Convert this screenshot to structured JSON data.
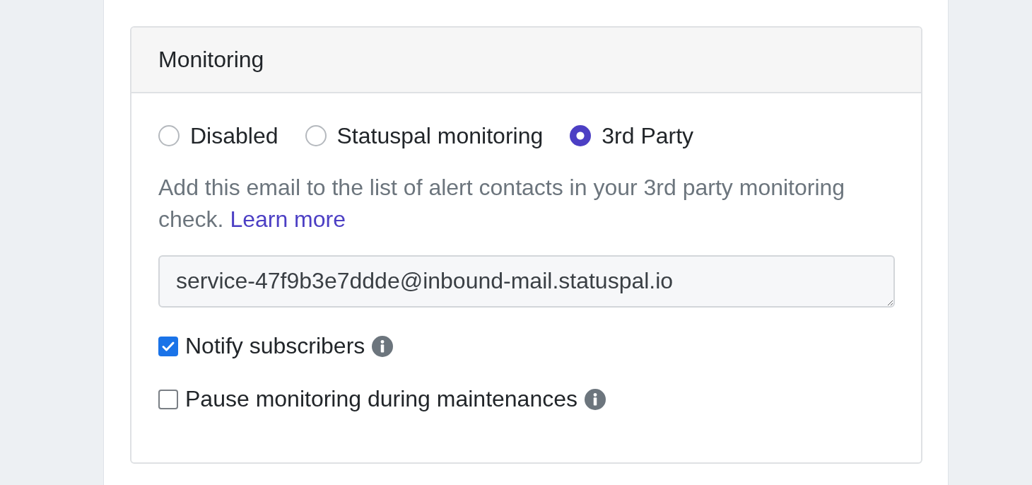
{
  "card": {
    "title": "Monitoring"
  },
  "monitoring_options": [
    {
      "label": "Disabled",
      "selected": false
    },
    {
      "label": "Statuspal monitoring",
      "selected": false
    },
    {
      "label": "3rd Party",
      "selected": true
    }
  ],
  "help": {
    "text": "Add this email to the list of alert contacts in your 3rd party monitoring check.",
    "link": "Learn more"
  },
  "email_field": {
    "value": "service-47f9b3e7ddde@inbound-mail.statuspal.io"
  },
  "options": [
    {
      "label": "Notify subscribers",
      "checked": true,
      "info": true
    },
    {
      "label": "Pause monitoring during maintenances",
      "checked": false,
      "info": true
    }
  ]
}
